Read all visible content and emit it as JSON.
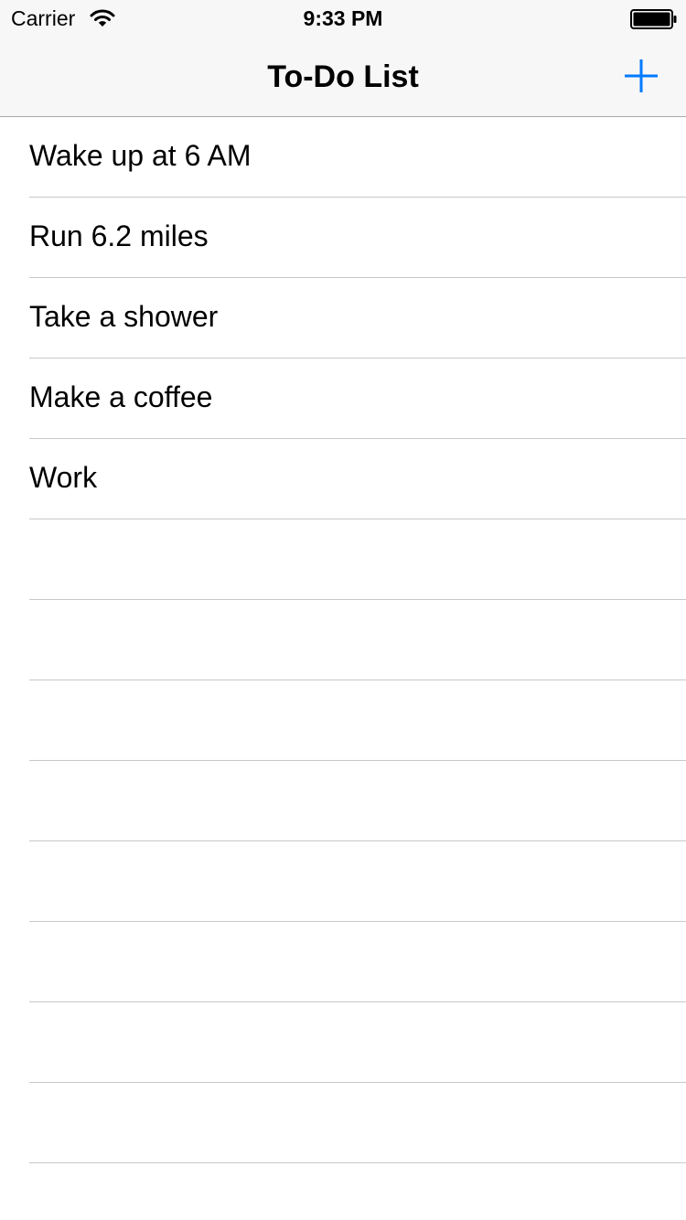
{
  "status_bar": {
    "carrier": "Carrier",
    "time": "9:33 PM",
    "wifi_icon": "wifi-icon",
    "battery_icon": "battery-full-icon"
  },
  "nav_bar": {
    "title": "To-Do List",
    "add_icon": "plus-icon"
  },
  "colors": {
    "accent": "#007aff",
    "header_background": "#f7f7f7",
    "separator": "#c8c7cc",
    "text": "#000000"
  },
  "todo_items": [
    {
      "label": "Wake up at 6 AM"
    },
    {
      "label": "Run 6.2 miles"
    },
    {
      "label": "Take a shower"
    },
    {
      "label": "Make a coffee"
    },
    {
      "label": "Work"
    },
    {
      "label": ""
    },
    {
      "label": ""
    },
    {
      "label": ""
    },
    {
      "label": ""
    },
    {
      "label": ""
    },
    {
      "label": ""
    },
    {
      "label": ""
    },
    {
      "label": ""
    },
    {
      "label": ""
    }
  ]
}
